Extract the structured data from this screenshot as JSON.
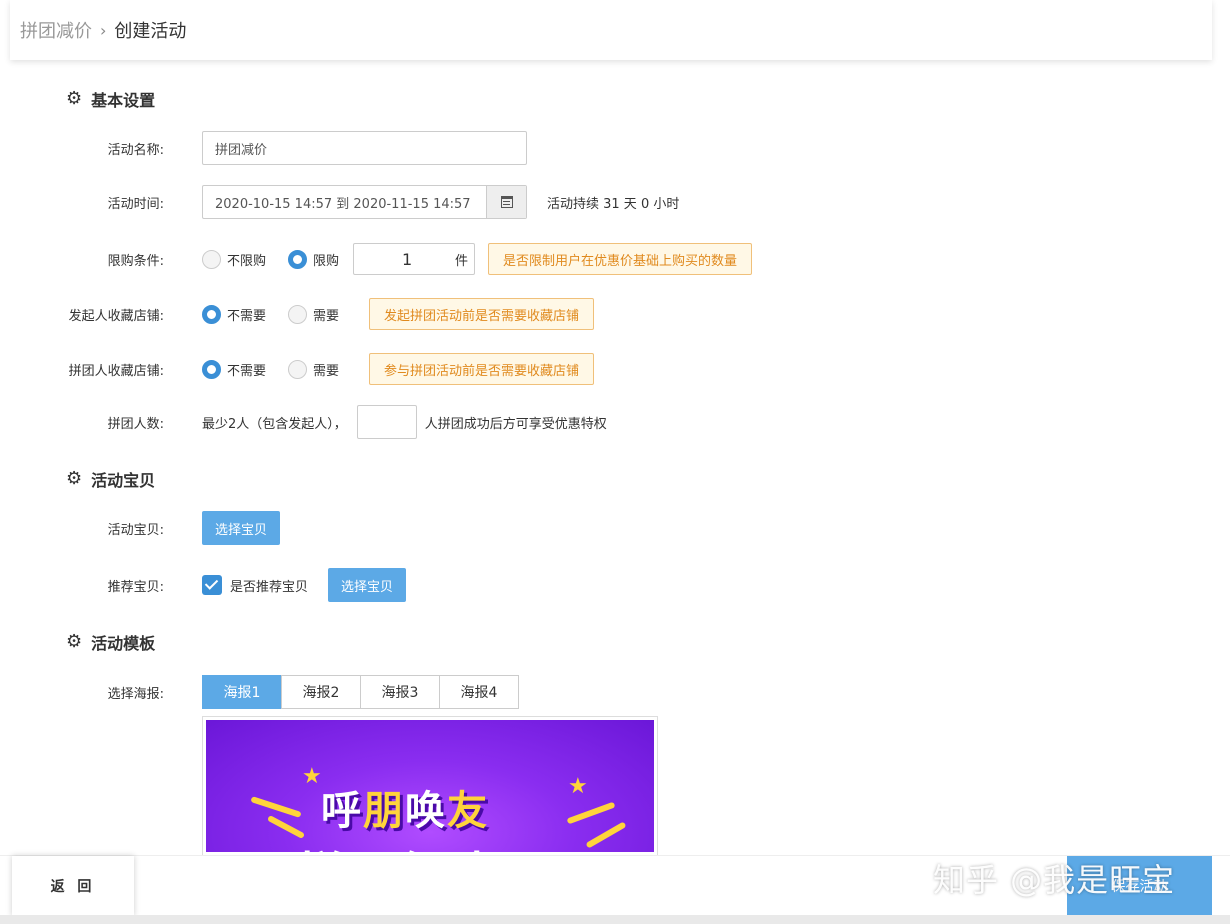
{
  "breadcrumb": {
    "parent": "拼团减价",
    "separator": "›",
    "current": "创建活动"
  },
  "sections": {
    "basic": "基本设置",
    "goods": "活动宝贝",
    "template": "活动模板"
  },
  "form": {
    "name_label": "活动名称:",
    "name_value": "拼团减价",
    "time_label": "活动时间:",
    "time_value": "2020-10-15 14:57 到 2020-11-15 14:57",
    "duration_text": "活动持续 31 天 0 小时",
    "limit_label": "限购条件:",
    "limit_options": [
      "不限购",
      "限购"
    ],
    "limit_selected": "限购",
    "limit_qty": "1",
    "limit_unit": "件",
    "limit_hint": "是否限制用户在优惠价基础上购买的数量",
    "initiator_label": "发起人收藏店铺:",
    "initiator_options": [
      "不需要",
      "需要"
    ],
    "initiator_selected": "不需要",
    "initiator_hint": "发起拼团活动前是否需要收藏店铺",
    "joiner_label": "拼团人收藏店铺:",
    "joiner_options": [
      "不需要",
      "需要"
    ],
    "joiner_selected": "不需要",
    "joiner_hint": "参与拼团活动前是否需要收藏店铺",
    "people_label": "拼团人数:",
    "people_prefix": "最少2人（包含发起人），",
    "people_value": "",
    "people_suffix": "人拼团成功后方可享受优惠特权",
    "goods_label": "活动宝贝:",
    "goods_button": "选择宝贝",
    "recommend_label": "推荐宝贝:",
    "recommend_checkbox": "是否推荐宝贝",
    "recommend_checked": true,
    "recommend_button": "选择宝贝",
    "poster_label": "选择海报:",
    "poster_tabs": [
      "海报1",
      "海报2",
      "海报3",
      "海报4"
    ],
    "poster_active": "海报1"
  },
  "poster": {
    "title_parts": [
      "呼",
      "朋",
      "唤",
      "友"
    ],
    "subtitle": "拼团钜惠"
  },
  "footer": {
    "back": "返 回",
    "save": "保存活动"
  },
  "watermark": "知乎 @我是旺宝",
  "colors": {
    "primary": "#5ca9e6",
    "radio": "#3a8fd6",
    "hint_border": "#f0c07a",
    "hint_text": "#e08a1e"
  }
}
